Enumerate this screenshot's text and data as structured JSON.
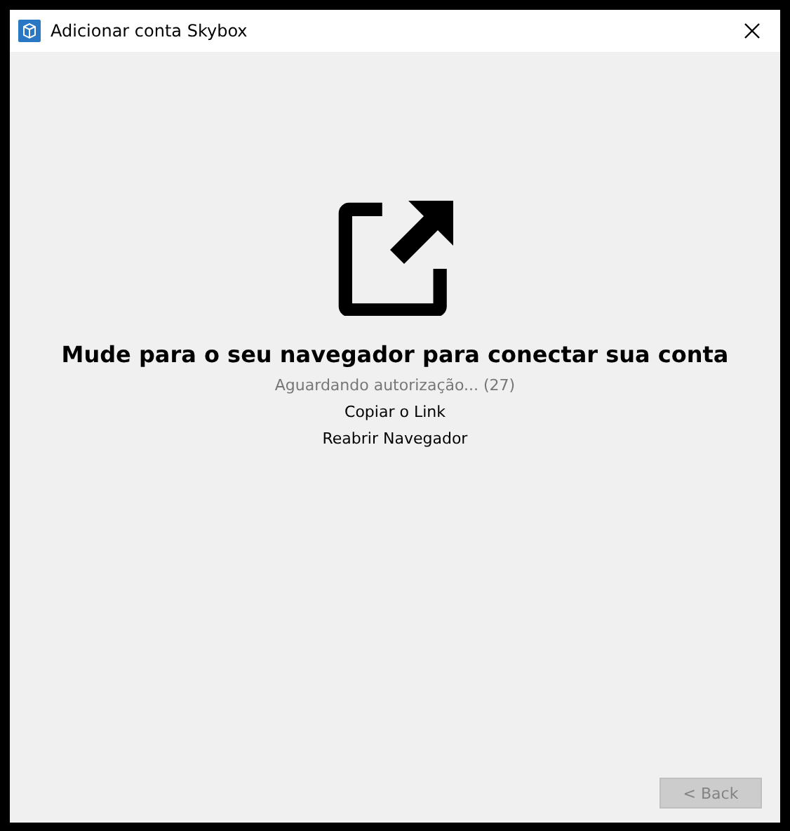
{
  "window": {
    "title": "Adicionar conta Skybox"
  },
  "heading": "Mude para o seu navegador para conectar sua conta",
  "status": "Aguardando autorização... (27)",
  "links": [
    "Copiar o Link",
    "Reabrir Navegador"
  ],
  "back_button": {
    "label": "< Back",
    "disabled": true
  }
}
